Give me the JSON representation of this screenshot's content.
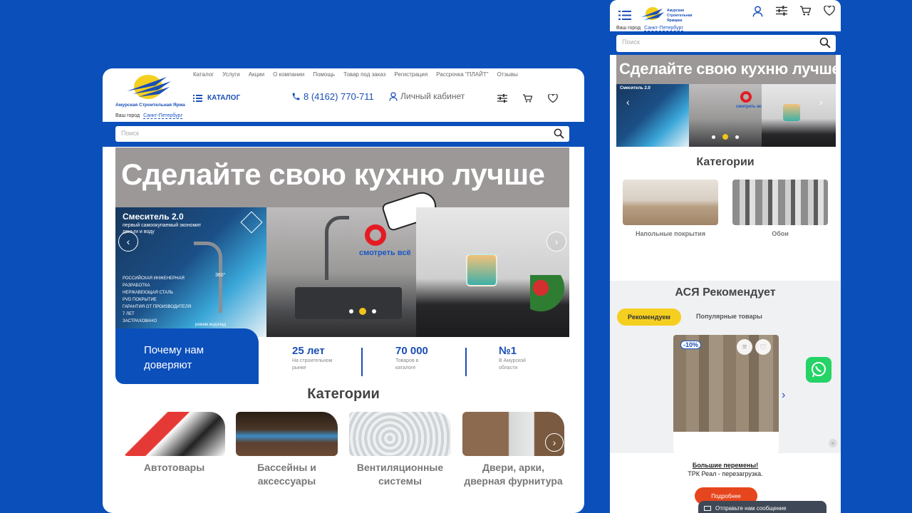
{
  "desktop": {
    "logo_text": "Амурская Строительная Ярмарка",
    "city_label": "Ваш город",
    "city_value": "Санкт-Петербург",
    "top_nav": [
      "Каталог",
      "Услуги",
      "Акции",
      "О компании",
      "Помощь",
      "Товар под заказ",
      "Регистрация",
      "Рассрочка \"ПЛАЙТ\"",
      "Отзывы"
    ],
    "catalog_label": "КАТАЛОГ",
    "phone": "8 (4162) 770-711",
    "cabinet": "Личный кабинет",
    "search_placeholder": "Поиск",
    "banner": {
      "headline": "Сделайте свою кухню лучше",
      "panel1_title": "Смеситель 2.0",
      "panel1_sub": "первый самоокупаемый экономит деньги и воду",
      "panel1_bullets": [
        "РОССИЙСКАЯ ИНЖЕНЕРНАЯ РАЗРАБОТКА",
        "НЕРЖАВЕЮЩАЯ СТАЛЬ",
        "PVD ПОКРЫТИЕ",
        "ГАРАНТИЯ ОТ ПРОИЗВОДИТЕЛЯ 7 ЛЕТ",
        "ЗАСТРАХОВАНО"
      ],
      "panel1_deg": "360°",
      "panel1_mode": "режим водопад",
      "see_all": "смотреть всё",
      "dots": 3,
      "active_dot": 2
    },
    "trust_label": "Почему нам доверяют",
    "stats": [
      {
        "value": "25 лет",
        "label": "На строительном рынке"
      },
      {
        "value": "70 000",
        "label": "Товаров в каталоге"
      },
      {
        "value": "№1",
        "label": "В Амурской области"
      }
    ],
    "categories_title": "Категории",
    "categories": [
      {
        "name": "Автотовары"
      },
      {
        "name": "Бассейны и аксессуары"
      },
      {
        "name": "Вентиляционные системы"
      },
      {
        "name": "Двери, арки, дверная фурнитура"
      }
    ]
  },
  "mobile": {
    "city_label": "Ваш город",
    "city_value": "Санкт-Петербург",
    "search_placeholder": "Поиск",
    "banner_headline": "Сделайте свою кухню лучше",
    "banner_panel1": "Смеситель 2.0",
    "banner_see_all": "смотреть всё",
    "categories_title": "Категории",
    "categories": [
      {
        "name": "Напольные покрытия"
      },
      {
        "name": "Обои"
      }
    ],
    "recommend_title": "АСЯ Рекомендует",
    "tab_active": "Рекомендуем",
    "tab_other": "Популярные товары",
    "discount": "-10%",
    "popup_title": "Большие перемены!",
    "popup_sub": "ТРК Реал - перезагрузка.",
    "popup_button": "Подробнее",
    "chat_label": "Отправьте нам сообщение"
  },
  "colors": {
    "brand_blue": "#0b4fbb",
    "accent_yellow": "#f5cf20",
    "accent_red": "#e6461d",
    "whatsapp_green": "#25d366"
  }
}
